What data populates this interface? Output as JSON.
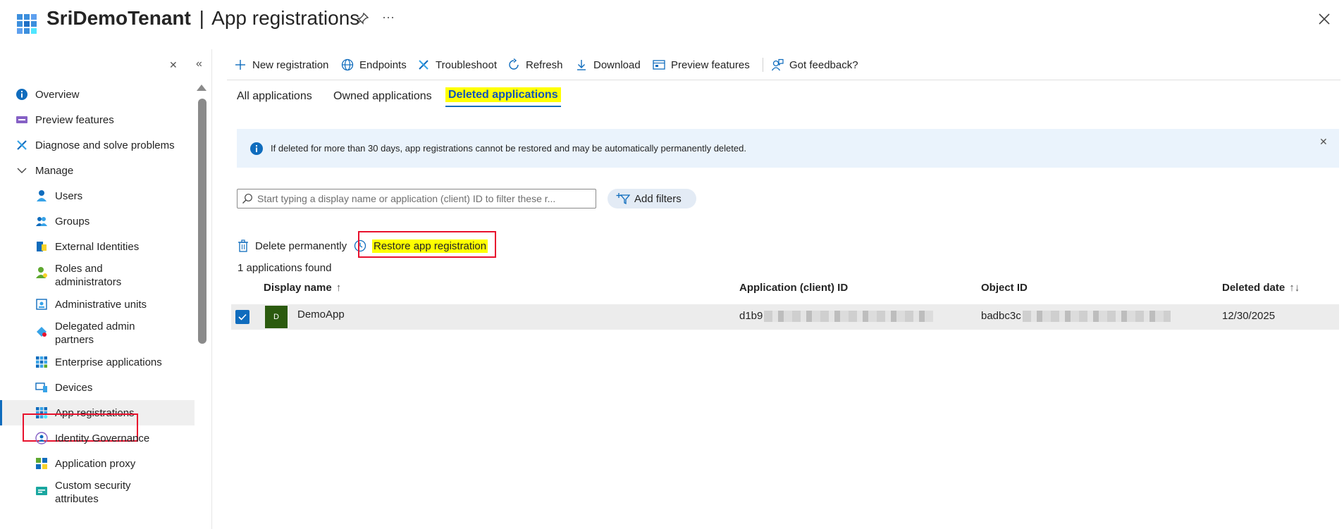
{
  "header": {
    "tenant": "SriDemoTenant",
    "separator": "|",
    "page": "App registrations",
    "more": "···"
  },
  "sidebar": {
    "items": [
      {
        "label": "Overview",
        "icon": "info-icon"
      },
      {
        "label": "Preview features",
        "icon": "preview-icon"
      },
      {
        "label": "Diagnose and solve problems",
        "icon": "wrench-icon"
      },
      {
        "label": "Manage",
        "icon": "chevron-down-icon"
      },
      {
        "label": "Users",
        "icon": "user-icon"
      },
      {
        "label": "Groups",
        "icon": "group-icon"
      },
      {
        "label": "External Identities",
        "icon": "external-identities-icon"
      },
      {
        "label": "Roles and administrators",
        "icon": "roles-icon"
      },
      {
        "label": "Administrative units",
        "icon": "admin-units-icon"
      },
      {
        "label": "Delegated admin partners",
        "icon": "delegated-admin-icon"
      },
      {
        "label": "Enterprise applications",
        "icon": "enterprise-apps-icon"
      },
      {
        "label": "Devices",
        "icon": "devices-icon"
      },
      {
        "label": "App registrations",
        "icon": "app-registrations-icon"
      },
      {
        "label": "Identity Governance",
        "icon": "identity-governance-icon"
      },
      {
        "label": "Application proxy",
        "icon": "app-proxy-icon"
      },
      {
        "label": "Custom security attributes",
        "icon": "custom-security-icon"
      }
    ],
    "close_glyph": "✕",
    "collapse_glyph": "«"
  },
  "toolbar": {
    "new_registration": "New registration",
    "endpoints": "Endpoints",
    "troubleshoot": "Troubleshoot",
    "refresh": "Refresh",
    "download": "Download",
    "preview_features": "Preview features",
    "got_feedback": "Got feedback?"
  },
  "tabs": [
    "All applications",
    "Owned applications",
    "Deleted applications"
  ],
  "info": {
    "text": "If deleted for more than 30 days, app registrations cannot be restored and may be automatically permanently deleted.",
    "close_glyph": "✕"
  },
  "search": {
    "placeholder": "Start typing a display name or application (client) ID to filter these r..."
  },
  "add_filters": "Add filters",
  "actions": {
    "delete": "Delete permanently",
    "restore": "Restore app registration"
  },
  "found": "1 applications found",
  "table": {
    "columns": [
      "Display name",
      "Application (client) ID",
      "Object ID",
      "Deleted date"
    ],
    "sort_up": "↑",
    "sort_both": "↑↓",
    "rows": [
      {
        "avatar": "D",
        "name": "DemoApp",
        "client_id_prefix": "d1b9",
        "object_id_prefix": "badbc3c",
        "deleted_date": "12/30/2025"
      }
    ]
  },
  "colors": {
    "accent": "#0f6cbd",
    "highlight": "#ffff00",
    "annotation_red": "#e8112d",
    "avatar_bg": "#2b5a0e",
    "banner_bg": "#eaf3fc"
  }
}
